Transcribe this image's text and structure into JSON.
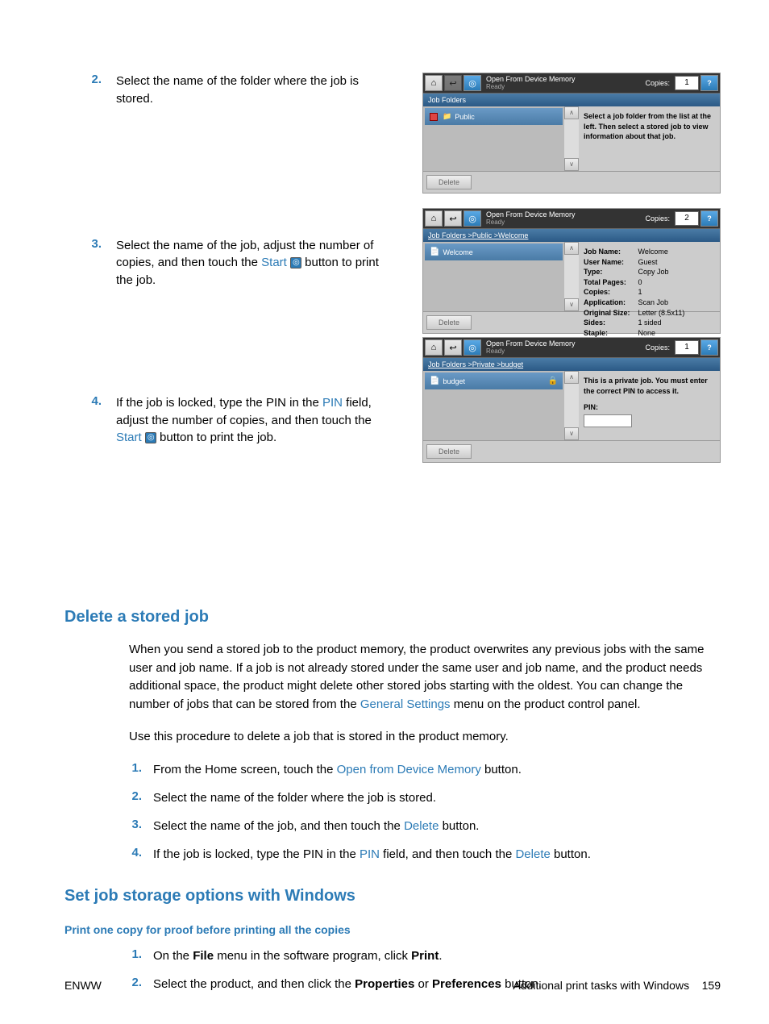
{
  "steps_top": [
    {
      "num": "2.",
      "text": "Select the name of the folder where the job is stored."
    },
    {
      "num": "3.",
      "pre": "Select the name of the job, adjust the number of copies, and then touch the ",
      "link": "Start",
      "post": " button to print the job.",
      "icon": true
    },
    {
      "num": "4.",
      "pre": "If the job is locked, type the PIN in the ",
      "link": "PIN",
      "mid": " field, adjust the number of copies, and then touch the ",
      "link2": "Start",
      "post": " button to print the job.",
      "icon": true
    }
  ],
  "panel1": {
    "title": "Open From Device Memory",
    "sub": "Ready",
    "copies_label": "Copies:",
    "copies": "1",
    "bar": "Job Folders",
    "item": "Public",
    "info": "Select a job folder from the list at the left. Then select a stored job to view information about that job.",
    "delete": "Delete"
  },
  "panel2": {
    "title": "Open From Device Memory",
    "sub": "Ready",
    "copies_label": "Copies:",
    "copies": "2",
    "bar": "Job Folders >Public >Welcome",
    "item": "Welcome",
    "labels": [
      "Job Name:",
      "User Name:",
      "Type:",
      "Total Pages:",
      "Copies:",
      "Application:",
      "Original Size:",
      "Sides:",
      "Staple:"
    ],
    "vals": [
      "Welcome",
      "Guest",
      "Copy Job",
      "0",
      "1",
      "Scan Job",
      "Letter (8.5x11)",
      "1 sided",
      "None"
    ],
    "delete": "Delete"
  },
  "panel3": {
    "title": "Open From Device Memory",
    "sub": "Ready",
    "copies_label": "Copies:",
    "copies": "1",
    "bar": "Job Folders >Private >budget",
    "item": "budget",
    "info": "This is a private job. You must enter the correct PIN to access it.",
    "pin_label": "PIN:",
    "delete": "Delete"
  },
  "section1": {
    "title": "Delete a stored job",
    "p1_a": "When you send a stored job to the product memory, the product overwrites any previous jobs with the same user and job name. If a job is not already stored under the same user and job name, and the product needs additional space, the product might delete other stored jobs starting with the oldest. You can change the number of jobs that can be stored from the ",
    "p1_link": "General Settings",
    "p1_b": " menu on the product control panel.",
    "p2": "Use this procedure to delete a job that is stored in the product memory.",
    "steps": [
      {
        "num": "1.",
        "pre": "From the Home screen, touch the ",
        "link": "Open from Device Memory",
        "post": " button."
      },
      {
        "num": "2.",
        "text": "Select the name of the folder where the job is stored."
      },
      {
        "num": "3.",
        "pre": "Select the name of the job, and then touch the ",
        "link": "Delete",
        "post": " button."
      },
      {
        "num": "4.",
        "pre": "If the job is locked, type the PIN in the ",
        "link": "PIN",
        "mid": " field, and then touch the ",
        "link2": "Delete",
        "post": " button."
      }
    ]
  },
  "section2": {
    "title": "Set job storage options with Windows",
    "sub": "Print one copy for proof before printing all the copies",
    "steps": [
      {
        "num": "1.",
        "a": "On the ",
        "b1": "File",
        "c": " menu in the software program, click ",
        "b2": "Print",
        "d": "."
      },
      {
        "num": "2.",
        "a": "Select the product, and then click the ",
        "b1": "Properties",
        "c": " or ",
        "b2": "Preferences",
        "d": " button."
      }
    ]
  },
  "footer": {
    "left": "ENWW",
    "right": "Additional print tasks with Windows",
    "page": "159"
  }
}
